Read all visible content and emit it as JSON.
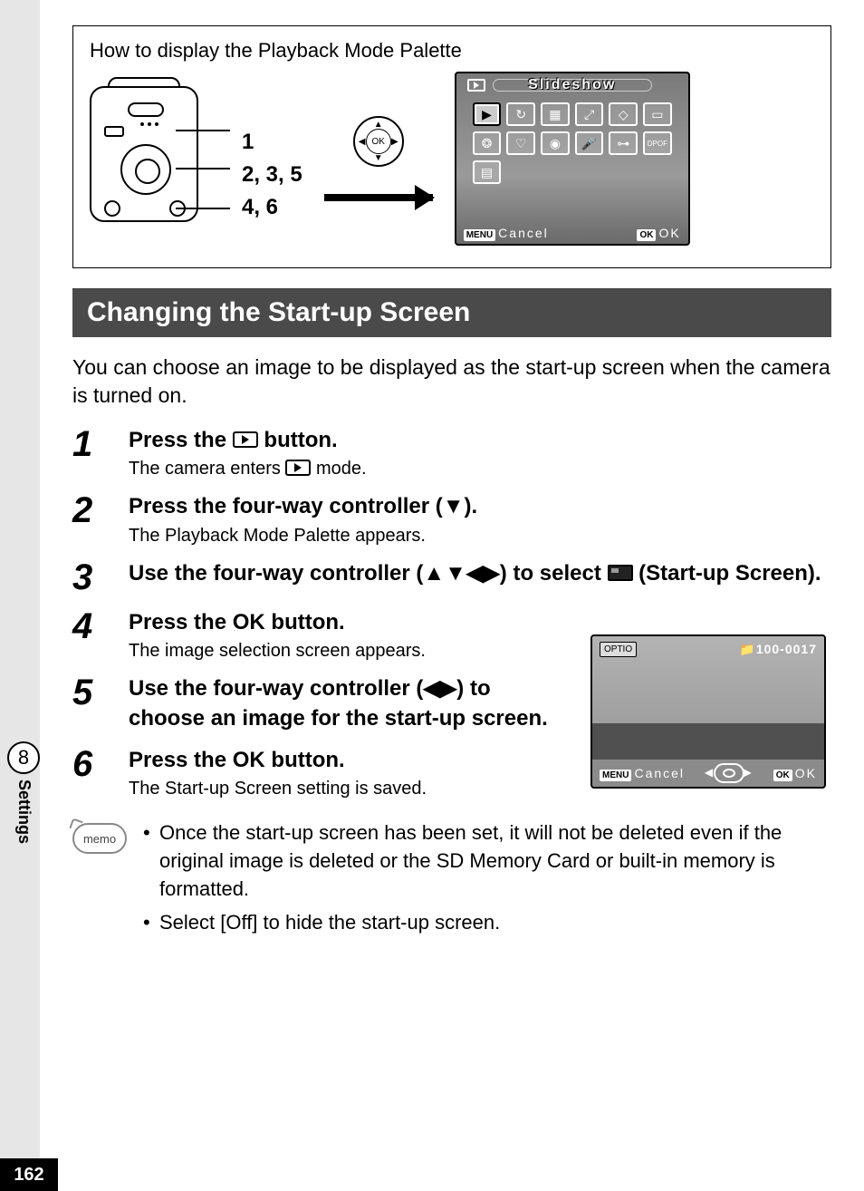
{
  "page_number": "162",
  "side_tab": {
    "number": "8",
    "label": "Settings"
  },
  "intro_box": {
    "title": "How to display the Playback Mode Palette",
    "callout_labels": [
      "1",
      "2, 3, 5",
      "4, 6"
    ]
  },
  "palette_screen": {
    "title": "Slideshow",
    "menu_label": "Cancel",
    "ok_label": "OK",
    "menu_tag": "MENU",
    "ok_tag": "OK",
    "icons": [
      "play",
      "rotate",
      "grid",
      "resize",
      "diamond",
      "frame",
      "gear",
      "heart",
      "eye",
      "rec",
      "key",
      "dpof",
      "film"
    ]
  },
  "heading": "Changing the Start-up Screen",
  "intro_paragraph": "You can choose an image to be displayed as the start-up screen when the camera is turned on.",
  "steps": [
    {
      "num": "1",
      "title_pre": "Press the ",
      "title_post": " button.",
      "sub_pre": "The camera enters ",
      "sub_post": " mode.",
      "shows_play_icon": true
    },
    {
      "num": "2",
      "title": "Press the four-way controller (▼).",
      "sub": "The Playback Mode Palette appears."
    },
    {
      "num": "3",
      "title_pre": "Use the four-way controller (▲▼◀▶) to select ",
      "title_post": " (Start-up Screen).",
      "shows_startup_icon": true
    },
    {
      "num": "4",
      "title_pre": "Press the ",
      "ok": "OK",
      "title_post": " button.",
      "sub": "The image selection screen appears."
    },
    {
      "num": "5",
      "title": "Use the four-way controller (◀▶) to choose an image for the start-up screen."
    },
    {
      "num": "6",
      "title_pre": "Press the ",
      "ok": "OK",
      "title_post": " button.",
      "sub": "The Start-up Screen setting is saved."
    }
  ],
  "shot2": {
    "top_left": "OPTIO",
    "top_right": "100-0017",
    "menu_tag": "MENU",
    "menu_label": "Cancel",
    "ok_tag": "OK",
    "ok_label": "OK"
  },
  "memo": {
    "badge": "memo",
    "items": [
      "Once the start-up screen has been set, it will not be deleted even if the original image is deleted or the SD Memory Card or built-in memory is formatted.",
      "Select [Off] to hide the start-up screen."
    ]
  }
}
